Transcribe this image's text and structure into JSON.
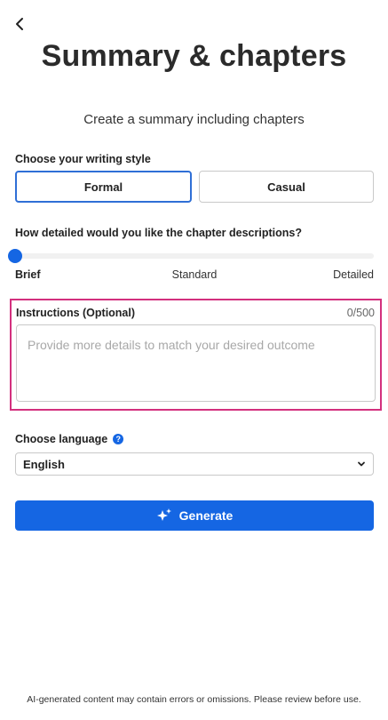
{
  "header": {
    "back_icon": "chevron-left-icon",
    "title": "Summary & chapters",
    "subtitle": "Create a summary including chapters"
  },
  "writing_style": {
    "label": "Choose your writing style",
    "options": [
      {
        "label": "Formal",
        "selected": true
      },
      {
        "label": "Casual",
        "selected": false
      }
    ]
  },
  "detail": {
    "label": "How detailed would you like the chapter descriptions?",
    "levels": [
      "Brief",
      "Standard",
      "Detailed"
    ],
    "selected_level": "Brief",
    "slider_value": 0
  },
  "instructions": {
    "label": "Instructions (Optional)",
    "counter": "0/500",
    "placeholder": "Provide more details to match your desired outcome",
    "value": "",
    "highlight_color": "#d3307e"
  },
  "language": {
    "label": "Choose language",
    "help_icon": "question-circle-icon",
    "selected": "English",
    "dropdown_icon": "chevron-down-icon"
  },
  "generate": {
    "label": "Generate",
    "icon": "sparkle-icon",
    "color": "#1566e3"
  },
  "footer": {
    "disclaimer": "AI-generated content may contain errors or omissions. Please review before use."
  }
}
